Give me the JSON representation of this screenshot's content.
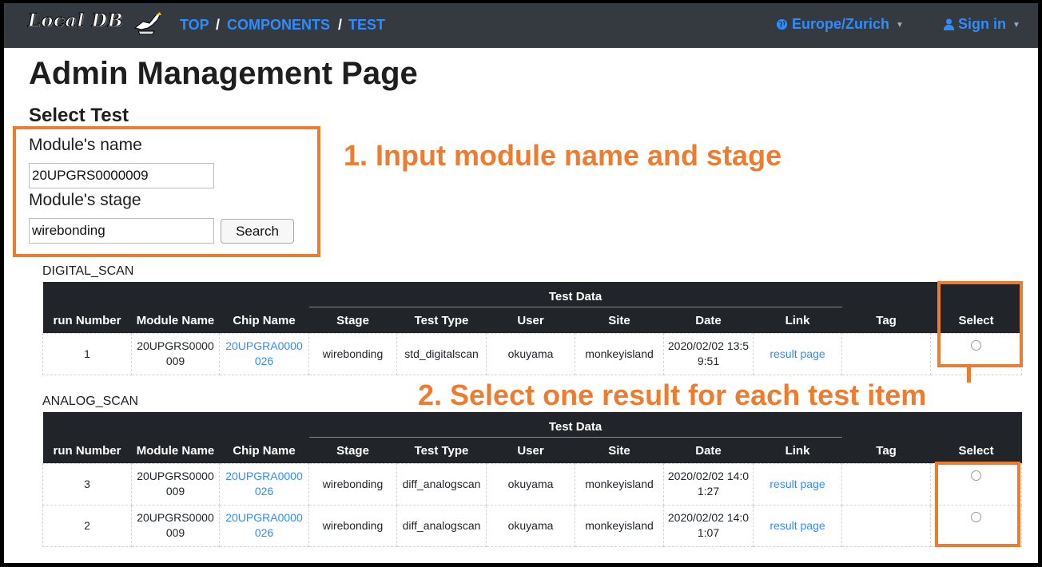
{
  "navbar": {
    "logo_text": "Local DB",
    "breadcrumb": [
      "TOP",
      "COMPONENTS",
      "TEST"
    ],
    "separator": "/",
    "timezone": "Europe/Zurich",
    "signin": "Sign in",
    "globe_icon": "globe-icon",
    "user_icon": "user-icon"
  },
  "page": {
    "title": "Admin Management Page",
    "section": "Select Test"
  },
  "form": {
    "module_name_label": "Module's name",
    "module_name_value": "20UPGRS0000009",
    "module_stage_label": "Module's stage",
    "module_stage_value": "wirebonding",
    "search_label": "Search"
  },
  "annotations": {
    "step1": "1. Input module name and stage",
    "step2": "2. Select one result for each test item",
    "accent": "#ec7c30"
  },
  "table_headers": {
    "run_number": "run Number",
    "module_name": "Module Name",
    "chip_name": "Chip Name",
    "test_data": "Test Data",
    "stage": "Stage",
    "test_type": "Test Type",
    "user": "User",
    "site": "Site",
    "date": "Date",
    "link": "Link",
    "tag": "Tag",
    "select": "Select"
  },
  "digital_scan": {
    "title": "DIGITAL_SCAN",
    "rows": [
      {
        "run": "1",
        "module": "20UPGRS0000009",
        "chip": "20UPGRA0000026",
        "stage": "wirebonding",
        "test_type": "std_digitalscan",
        "user": "okuyama",
        "site": "monkeyisland",
        "date": "2020/02/02 13:59:51",
        "link": "result page",
        "tag": ""
      }
    ]
  },
  "analog_scan": {
    "title": "ANALOG_SCAN",
    "rows": [
      {
        "run": "3",
        "module": "20UPGRS0000009",
        "chip": "20UPGRA0000026",
        "stage": "wirebonding",
        "test_type": "diff_analogscan",
        "user": "okuyama",
        "site": "monkeyisland",
        "date": "2020/02/02 14:01:27",
        "link": "result page",
        "tag": ""
      },
      {
        "run": "2",
        "module": "20UPGRS0000009",
        "chip": "20UPGRA0000026",
        "stage": "wirebonding",
        "test_type": "diff_analogscan",
        "user": "okuyama",
        "site": "monkeyisland",
        "date": "2020/02/02 14:01:07",
        "link": "result page",
        "tag": ""
      }
    ]
  }
}
